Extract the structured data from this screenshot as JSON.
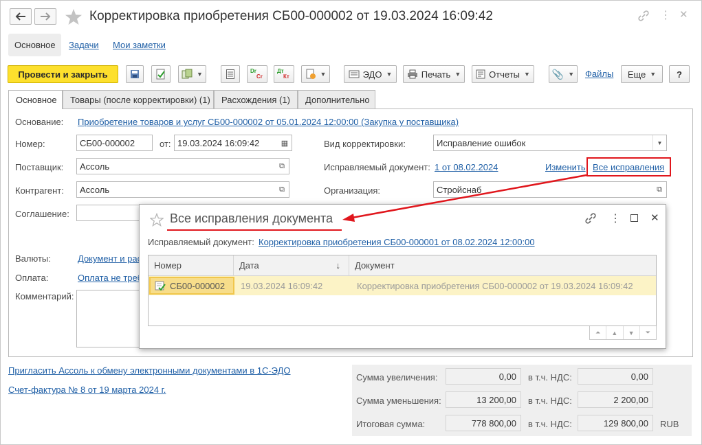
{
  "window": {
    "title": "Корректировка приобретения СБ00-000002 от 19.03.2024 16:09:42"
  },
  "sections": [
    "Основное",
    "Задачи",
    "Мои заметки"
  ],
  "toolbar": {
    "post_close": "Провести и закрыть",
    "edo": "ЭДО",
    "print": "Печать",
    "reports": "Отчеты",
    "files": "Файлы",
    "more": "Еще",
    "help": "?",
    "icon_dt": "Дт",
    "icon_kt": "Кт",
    "icon_dr": "Dr",
    "icon_cr": "Cr"
  },
  "tabs": [
    "Основное",
    "Товары (после корректировки) (1)",
    "Расхождения (1)",
    "Дополнительно"
  ],
  "form": {
    "basis_label": "Основание:",
    "basis_link": "Приобретение товаров и услуг СБ00-000002 от 05.01.2024 12:00:00 (Закупка у поставщика)",
    "number_label": "Номер:",
    "number_value": "СБ00-000002",
    "date_label": "от:",
    "date_value": "19.03.2024 16:09:42",
    "supplier_label": "Поставщик:",
    "supplier_value": "Ассоль",
    "contractor_label": "Контрагент:",
    "contractor_value": "Ассоль",
    "agreement_label": "Соглашение:",
    "currency_label": "Валюты:",
    "currency_link": "Документ и рас",
    "payment_label": "Оплата:",
    "payment_link": "Оплата не треб",
    "comment_label": "Комментарий:",
    "corr_type_label": "Вид корректировки:",
    "corr_type_value": "Исправление ошибок",
    "corrected_doc_label": "Исправляемый документ:",
    "corrected_doc_link": "1 от 08.02.2024",
    "change_link": "Изменить",
    "all_corrections_link": "Все исправления",
    "org_label": "Организация:",
    "org_value": "Стройснаб"
  },
  "footer_links": {
    "invite": "Пригласить Ассоль к обмену электронными документами в 1С-ЭДО",
    "invoice": "Счет-фактура № 8 от 19 марта 2024 г."
  },
  "totals": {
    "increase_label": "Сумма увеличения:",
    "increase_value": "0,00",
    "increase_vat_label": "в т.ч. НДС:",
    "increase_vat": "0,00",
    "decrease_label": "Сумма уменьшения:",
    "decrease_value": "13 200,00",
    "decrease_vat_label": "в т.ч. НДС:",
    "decrease_vat": "2 200,00",
    "total_label": "Итоговая сумма:",
    "total_value": "778 800,00",
    "total_vat_label": "в т.ч. НДС:",
    "total_vat": "129 800,00",
    "currency": "RUB"
  },
  "popup": {
    "title": "Все исправления документа",
    "doc_label": "Исправляемый документ:",
    "doc_link": "Корректировка приобретения СБ00-000001 от 08.02.2024 12:00:00",
    "columns": [
      "Номер",
      "Дата",
      "Документ"
    ],
    "sort_indicator": "↓",
    "rows": [
      {
        "number": "СБ00-000002",
        "date": "19.03.2024 16:09:42",
        "document": "Корректировка приобретения СБ00-000002 от 19.03.2024 16:09:42"
      }
    ]
  },
  "colors": {
    "accent_yellow": "#fde02d",
    "link_blue": "#1f5fa6",
    "annotation_red": "#e0161c",
    "row_selected": "#fcf3c6"
  }
}
